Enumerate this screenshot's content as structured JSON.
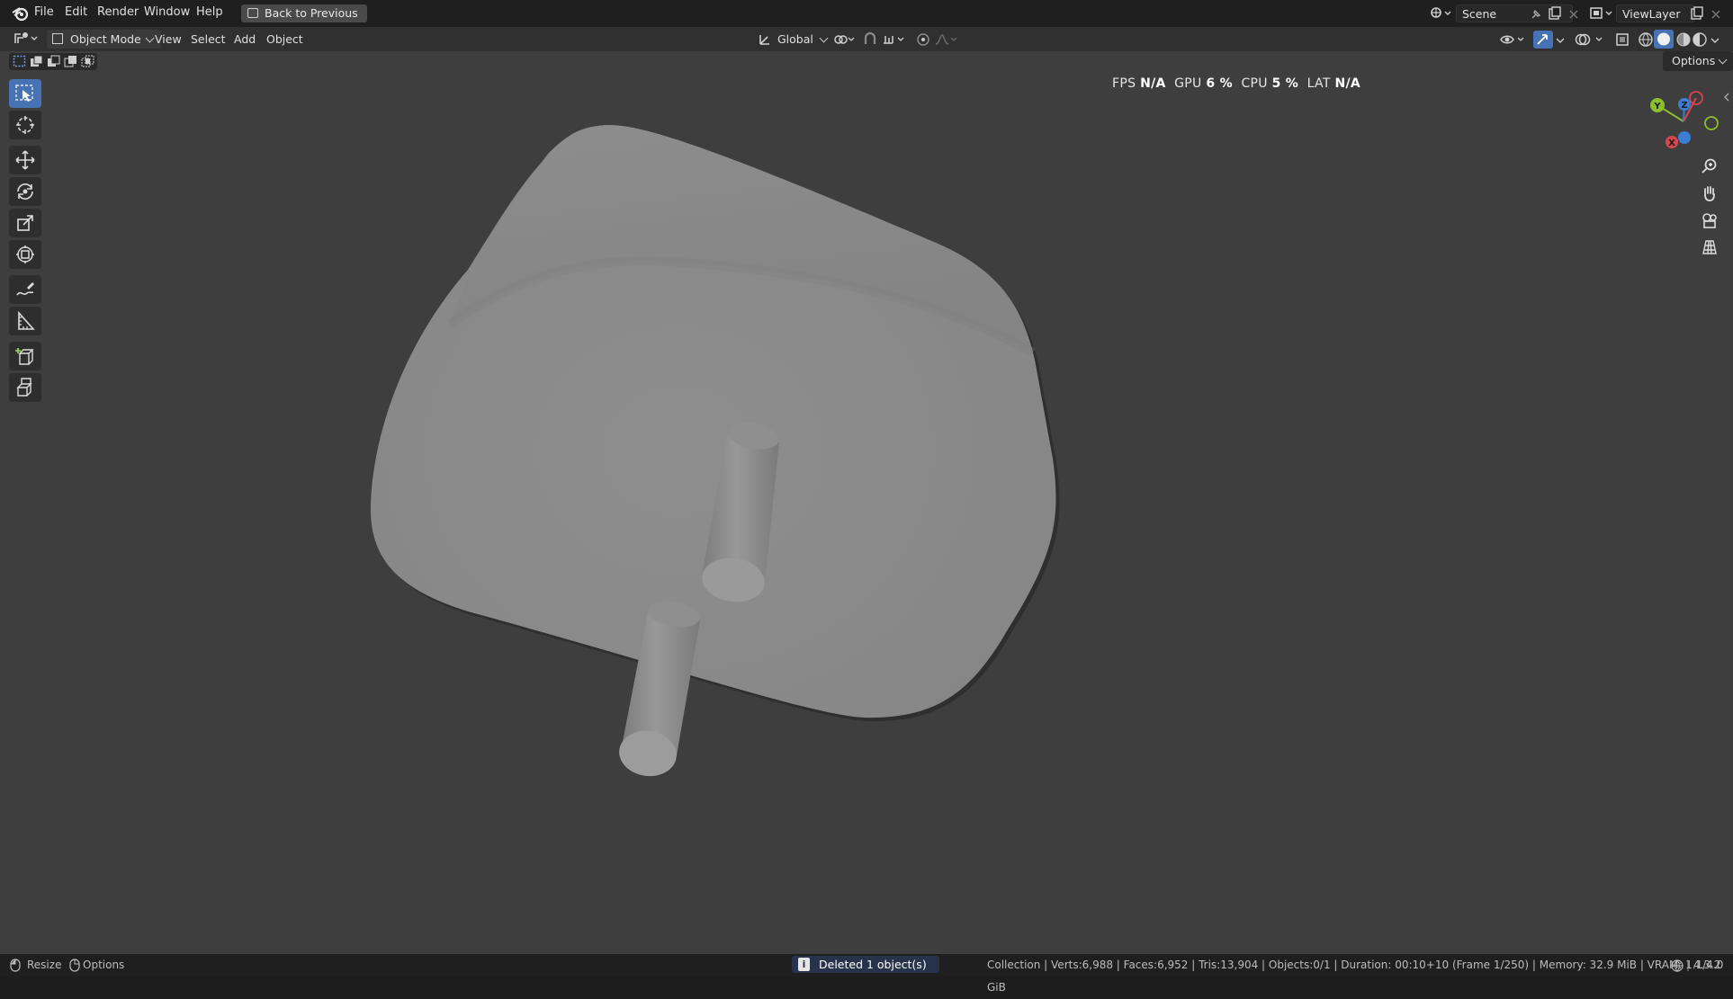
{
  "menubar": {
    "items": [
      "File",
      "Edit",
      "Render",
      "Window",
      "Help"
    ],
    "back_button": "Back to Previous",
    "scene_field": "Scene",
    "viewlayer_field": "ViewLayer"
  },
  "header": {
    "mode": "Object Mode",
    "menus": [
      "View",
      "Select",
      "Add",
      "Object"
    ],
    "transform_orientation": "Global",
    "options_label": "Options"
  },
  "stats_overlay": {
    "fps_label": "FPS",
    "fps_value": "N/A",
    "gpu_label": "GPU",
    "gpu_value": "6 %",
    "cpu_label": "CPU",
    "cpu_value": "5 %",
    "lat_label": "LAT",
    "lat_value": "N/A"
  },
  "toolbar": {
    "tools": [
      "select-box-icon",
      "cursor-icon",
      "move-icon",
      "rotate-icon",
      "scale-icon",
      "transform-icon",
      "annotate-icon",
      "measure-icon",
      "add-cube-icon",
      "extrude-icon"
    ],
    "active_tool": "select-box-icon"
  },
  "gizmo": {
    "axes": [
      "Y",
      "Z",
      "X"
    ],
    "colors": {
      "x": "#d9434e",
      "y": "#8bbf2b",
      "z": "#3a7fd4"
    }
  },
  "statusbar": {
    "left_items": [
      "Resize",
      "Options"
    ],
    "report": "Deleted 1 object(s)",
    "info": "Collection | Verts:6,988 | Faces:6,952 | Tris:13,904 | Objects:0/1 | Duration: 00:10+10 (Frame 1/250) | Memory: 32.9 MiB | VRAM: 1.1/4.0 GiB",
    "version": "4.3.2"
  },
  "colors": {
    "accent": "#4772b3",
    "viewport_bg": "#3e3e3e",
    "mesh": "#8a8a8a"
  }
}
